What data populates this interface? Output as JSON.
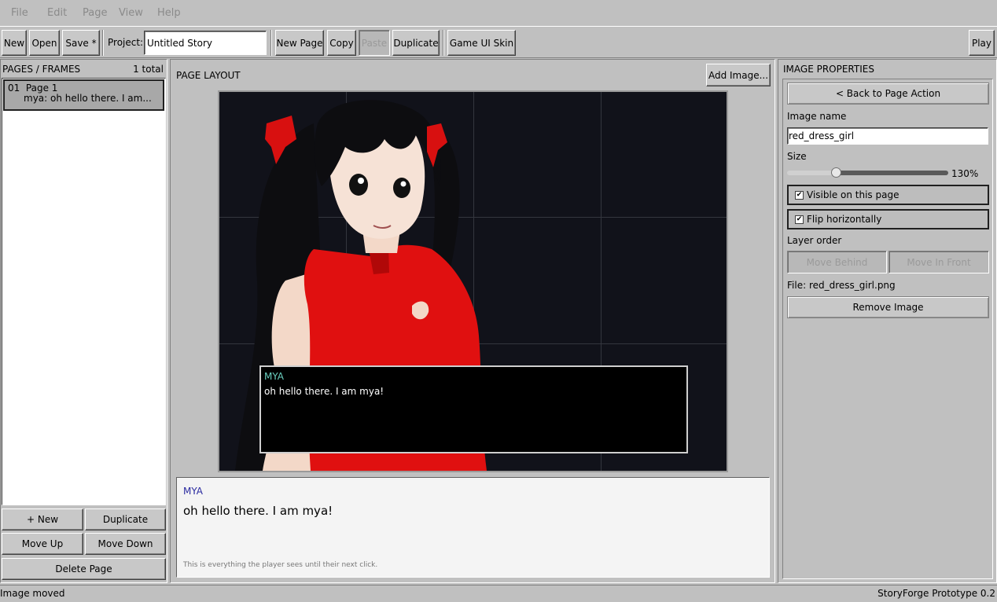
{
  "menubar": {
    "file": "File",
    "edit": "Edit",
    "page": "Page",
    "view": "View",
    "help": "Help"
  },
  "toolbar": {
    "new": "New",
    "open": "Open",
    "save": "Save *",
    "project_label": "Project:",
    "project_value": "Untitled Story",
    "new_page": "New Page",
    "copy": "Copy",
    "paste": "Paste",
    "duplicate": "Duplicate",
    "game_ui_skin": "Game UI Skin",
    "play": "Play"
  },
  "pages_panel": {
    "title": "PAGES / FRAMES",
    "count": "1 total",
    "items": [
      {
        "label": "01  Page 1",
        "preview": "mya: oh hello there. I am..."
      }
    ],
    "buttons": {
      "new": "+ New",
      "duplicate": "Duplicate",
      "move_up": "Move Up",
      "move_down": "Move Down",
      "delete": "Delete Page"
    }
  },
  "layout_panel": {
    "title": "PAGE LAYOUT",
    "add_image": "Add Image...",
    "dialog": {
      "speaker": "MYA",
      "text": "oh hello there. I am mya!"
    },
    "preview": {
      "speaker": "MYA",
      "text": "oh hello there. I am mya!",
      "hint": "This is everything the player sees until their next click."
    }
  },
  "image_props": {
    "title": "IMAGE PROPERTIES",
    "back": "< Back to Page Action",
    "name_label": "Image name",
    "name_value": "red_dress_girl",
    "size_label": "Size",
    "size_value": "130%",
    "size_fraction": 0.3,
    "visible_label": "Visible on this page",
    "flip_label": "Flip horizontally",
    "layer_label": "Layer order",
    "move_behind": "Move Behind",
    "move_front": "Move In Front",
    "file": "File: red_dress_girl.png",
    "remove": "Remove Image"
  },
  "colors": {
    "speaker": "#6ad0c0",
    "preview_speaker": "#2a2aa0",
    "dress": "#e01010",
    "hair": "#0d0d10"
  },
  "status": {
    "left": "Image moved",
    "right": "StoryForge Prototype 0.2"
  }
}
